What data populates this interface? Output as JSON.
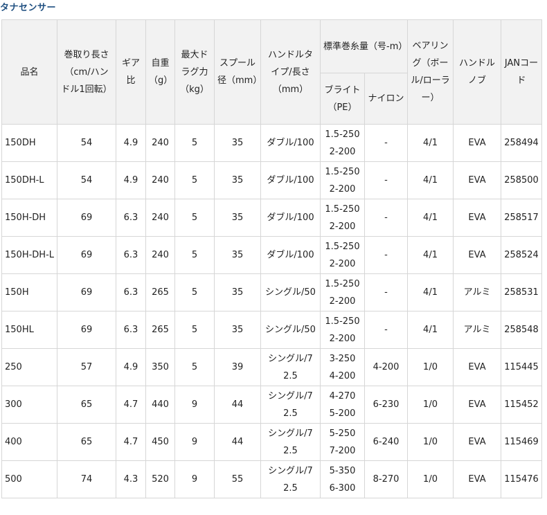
{
  "page": {
    "title": "タナセンサー"
  },
  "table": {
    "headers": {
      "name": "品名",
      "retrieve": "巻取り長さ（cm/ハンドル1回転）",
      "gear": "ギア比",
      "weight": "自重（g）",
      "drag": "最大ドラグ力（kg）",
      "spool": "スプール径（mm）",
      "handle": "ハンドルタイプ/長さ（mm）",
      "line_group": "標準巻糸量（号-m）",
      "line_pe": "ブライト（PE）",
      "line_nylon": "ナイロン",
      "bearing": "ベアリング（ボール/ローラー）",
      "knob": "ハンドルノブ",
      "jan": "JANコード"
    },
    "rows": [
      {
        "name": "150DH",
        "retrieve": "54",
        "gear": "4.9",
        "weight": "240",
        "drag": "5",
        "spool": "35",
        "handle": "ダブル/100",
        "pe_1": "1.5-250",
        "pe_2": "2-200",
        "nylon": "-",
        "bearing": "4/1",
        "knob": "EVA",
        "jan": "258494"
      },
      {
        "name": "150DH-L",
        "retrieve": "54",
        "gear": "4.9",
        "weight": "240",
        "drag": "5",
        "spool": "35",
        "handle": "ダブル/100",
        "pe_1": "1.5-250",
        "pe_2": "2-200",
        "nylon": "-",
        "bearing": "4/1",
        "knob": "EVA",
        "jan": "258500"
      },
      {
        "name": "150H-DH",
        "retrieve": "69",
        "gear": "6.3",
        "weight": "240",
        "drag": "5",
        "spool": "35",
        "handle": "ダブル/100",
        "pe_1": "1.5-250",
        "pe_2": "2-200",
        "nylon": "-",
        "bearing": "4/1",
        "knob": "EVA",
        "jan": "258517"
      },
      {
        "name": "150H-DH-L",
        "retrieve": "69",
        "gear": "6.3",
        "weight": "240",
        "drag": "5",
        "spool": "35",
        "handle": "ダブル/100",
        "pe_1": "1.5-250",
        "pe_2": "2-200",
        "nylon": "-",
        "bearing": "4/1",
        "knob": "EVA",
        "jan": "258524"
      },
      {
        "name": "150H",
        "retrieve": "69",
        "gear": "6.3",
        "weight": "265",
        "drag": "5",
        "spool": "35",
        "handle": "シングル/50",
        "pe_1": "1.5-250",
        "pe_2": "2-200",
        "nylon": "-",
        "bearing": "4/1",
        "knob": "アルミ",
        "jan": "258531"
      },
      {
        "name": "150HL",
        "retrieve": "69",
        "gear": "6.3",
        "weight": "265",
        "drag": "5",
        "spool": "35",
        "handle": "シングル/50",
        "pe_1": "1.5-250",
        "pe_2": "2-200",
        "nylon": "-",
        "bearing": "4/1",
        "knob": "アルミ",
        "jan": "258548"
      },
      {
        "name": "250",
        "retrieve": "57",
        "gear": "4.9",
        "weight": "350",
        "drag": "5",
        "spool": "39",
        "handle": "シングル/72.5",
        "pe_1": "3-250",
        "pe_2": "4-200",
        "nylon": "4-200",
        "bearing": "1/0",
        "knob": "EVA",
        "jan": "115445"
      },
      {
        "name": "300",
        "retrieve": "65",
        "gear": "4.7",
        "weight": "440",
        "drag": "9",
        "spool": "44",
        "handle": "シングル/72.5",
        "pe_1": "4-270",
        "pe_2": "5-200",
        "nylon": "6-230",
        "bearing": "1/0",
        "knob": "EVA",
        "jan": "115452"
      },
      {
        "name": "400",
        "retrieve": "65",
        "gear": "4.7",
        "weight": "450",
        "drag": "9",
        "spool": "44",
        "handle": "シングル/72.5",
        "pe_1": "5-250",
        "pe_2": "7-200",
        "nylon": "6-240",
        "bearing": "1/0",
        "knob": "EVA",
        "jan": "115469"
      },
      {
        "name": "500",
        "retrieve": "74",
        "gear": "4.3",
        "weight": "520",
        "drag": "9",
        "spool": "55",
        "handle": "シングル/72.5",
        "pe_1": "5-350",
        "pe_2": "6-300",
        "nylon": "8-270",
        "bearing": "1/0",
        "knob": "EVA",
        "jan": "115476"
      }
    ]
  }
}
